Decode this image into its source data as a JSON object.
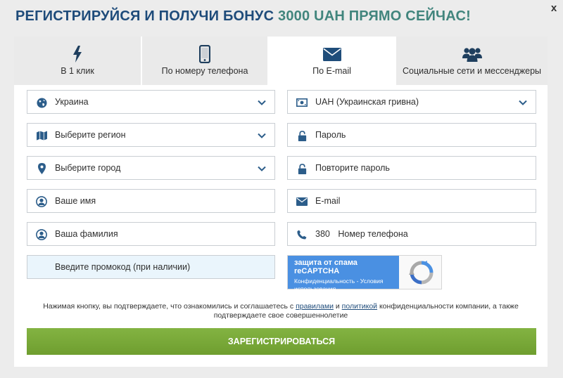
{
  "header": {
    "title_main": "РЕГИСТРИРУЙСЯ И ПОЛУЧИ БОНУС",
    "title_accent": "3000 UAH ПРЯМО СЕЙЧАС!",
    "close_label": "x"
  },
  "tabs": [
    {
      "label": "В 1 клик",
      "icon": "lightning-icon",
      "active": false
    },
    {
      "label": "По номеру телефона",
      "icon": "phone-icon",
      "active": false
    },
    {
      "label": "По E-mail",
      "icon": "envelope-icon",
      "active": true
    },
    {
      "label": "Социальные сети и мессенджеры",
      "icon": "users-icon",
      "active": false
    }
  ],
  "form": {
    "country": {
      "value": "Украина",
      "icon": "globe-icon"
    },
    "currency": {
      "value": "UAH (Украинская гривна)",
      "icon": "money-icon"
    },
    "region": {
      "placeholder": "Выберите регион",
      "icon": "map-icon"
    },
    "password": {
      "placeholder": "Пароль",
      "icon": "lock-icon"
    },
    "city": {
      "placeholder": "Выберите город",
      "icon": "location-pin-icon"
    },
    "password_repeat": {
      "placeholder": "Повторите пароль",
      "icon": "lock-icon"
    },
    "first_name": {
      "placeholder": "Ваше имя",
      "icon": "user-icon"
    },
    "email": {
      "placeholder": "E-mail",
      "icon": "envelope-icon"
    },
    "last_name": {
      "placeholder": "Ваша фамилия",
      "icon": "user-icon"
    },
    "phone": {
      "prefix": "380",
      "placeholder": "Номер телефона",
      "icon": "phone-icon"
    },
    "promo": {
      "placeholder": "Введите промокод (при наличии)"
    }
  },
  "recaptcha": {
    "title": "защита от спама reCAPTCHA",
    "privacy": "Конфиденциальность",
    "separator": " - ",
    "terms": "Условия использования"
  },
  "consent": {
    "text_before": "Нажимая кнопку, вы подтверждаете, что ознакомились и соглашаетесь с ",
    "rules_link": "правилами",
    "text_and": " и ",
    "policy_link": "политикой",
    "text_after": " конфиденциальности компании, а также подтверждаете свое совершеннолетие"
  },
  "register_button": {
    "label": "ЗАРЕГИСТРИРОВАТЬСЯ"
  },
  "colors": {
    "title_blue": "#1e4b7a",
    "title_accent": "#41857d",
    "icon_blue": "#2c5d8a",
    "button_green": "#7aa83a",
    "recaptcha_blue": "#4a90e2",
    "promo_bg": "#eaf5fc"
  }
}
